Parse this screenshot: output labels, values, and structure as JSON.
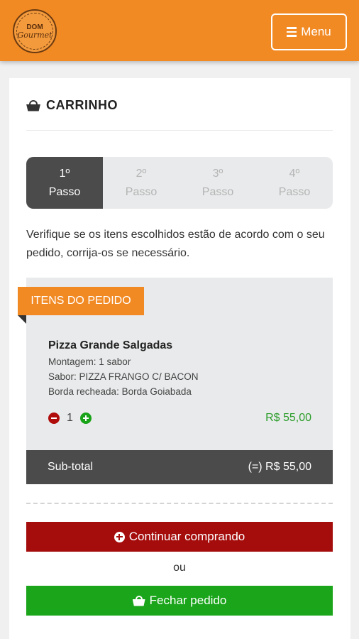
{
  "header": {
    "logo_text_1": "DOM",
    "logo_text_2": "Gourmet",
    "menu_label": "Menu",
    "brand_color": "#f28a24"
  },
  "page": {
    "title": "CARRINHO",
    "title_icon": "basket-icon"
  },
  "steps": [
    {
      "number": "1º",
      "label": "Passo",
      "active": true
    },
    {
      "number": "2º",
      "label": "Passo",
      "active": false
    },
    {
      "number": "3º",
      "label": "Passo",
      "active": false
    },
    {
      "number": "4º",
      "label": "Passo",
      "active": false
    }
  ],
  "instructions": "Verifique se os itens escolhidos estão de acordo com o seu pedido, corrija-os se necessário.",
  "order": {
    "section_label": "ITENS DO PEDIDO",
    "items": [
      {
        "name": "Pizza Grande Salgadas",
        "details": [
          "Montagem: 1 sabor",
          "Sabor: PIZZA FRANGO C/ BACON",
          "Borda recheada: Borda Goiabada"
        ],
        "quantity": "1",
        "price": "R$ 55,00"
      }
    ],
    "subtotal_label": "Sub-total",
    "subtotal_value": "(=) R$ 55,00"
  },
  "actions": {
    "continue_label": "Continuar comprando",
    "or_label": "ou",
    "close_label": "Fechar pedido",
    "continue_color": "#a50c0c",
    "close_color": "#1aa51a"
  }
}
